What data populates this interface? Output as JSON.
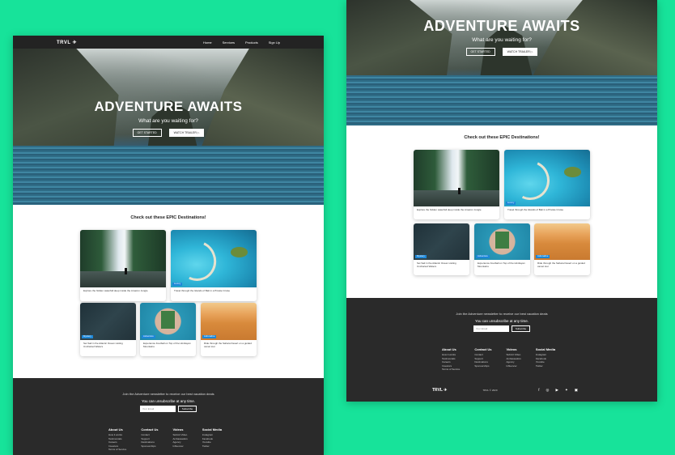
{
  "brand": {
    "logo": "TRVL ✈"
  },
  "nav": {
    "links": [
      "Home",
      "Services",
      "Products",
      "Sign Up"
    ]
  },
  "hero": {
    "title": "ADVENTURE AWAITS",
    "subtitle": "What are you waiting for?",
    "btn_primary": "GET STARTED",
    "btn_secondary": "WATCH TRAILER ▷"
  },
  "destinations": {
    "heading": "Check out these EPIC Destinations!",
    "cards": [
      {
        "tag": "Adventure",
        "caption": "Explore the hidden waterfall deep inside the Amazon Jungle"
      },
      {
        "tag": "Luxury",
        "caption": "Travel through the Islands of Bali in a Private Cruise"
      },
      {
        "tag": "Mystery",
        "caption": "Set Sail in the Atlantic Ocean visiting Uncharted Waters"
      },
      {
        "tag": "Adventure",
        "caption": "Experience Football on Top of the Himilayan Mountains"
      },
      {
        "tag": "Adrenaline",
        "caption": "Ride through the Sahara Desert on a guided camel tour"
      }
    ]
  },
  "footer": {
    "message": "Join the Adventure newsletter to receive our best vacation deals",
    "subscribe_text": "You can unsubscribe at any time.",
    "email_placeholder": "Your Email",
    "subscribe_btn": "Subscribe",
    "columns": [
      {
        "title": "About Us",
        "links": [
          "How it works",
          "Testimonials",
          "Careers",
          "Investors",
          "Terms of Service"
        ]
      },
      {
        "title": "Contact Us",
        "links": [
          "Contact",
          "Support",
          "Destinations",
          "Sponsorships"
        ]
      },
      {
        "title": "Videos",
        "links": [
          "Submit Video",
          "Ambassadors",
          "Agency",
          "Influencer"
        ]
      },
      {
        "title": "Social Media",
        "links": [
          "Instagram",
          "Facebook",
          "Youtube",
          "Twitter"
        ]
      }
    ],
    "copyright": "TRVL © 2020",
    "social_icons": [
      "facebook-icon",
      "instagram-icon",
      "youtube-icon",
      "twitter-icon",
      "linkedin-icon"
    ]
  }
}
